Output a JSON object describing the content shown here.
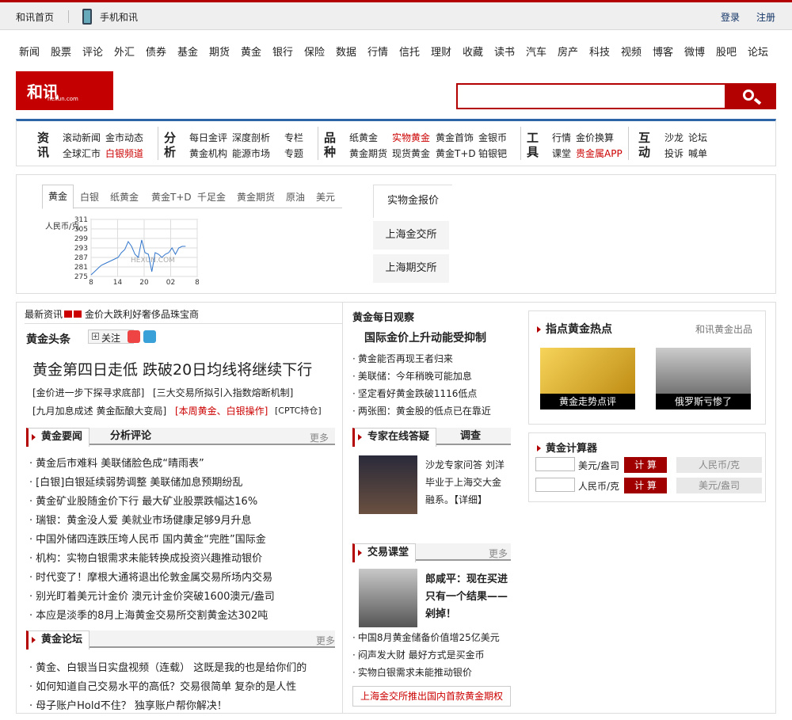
{
  "topbar": {
    "home": "和讯首页",
    "mobile": "手机和讯",
    "login": "登录",
    "register": "注册"
  },
  "nav": [
    "新闻",
    "股票",
    "评论",
    "外汇",
    "债券",
    "基金",
    "期货",
    "黄金",
    "银行",
    "保险",
    "数据",
    "行情",
    "信托",
    "理财",
    "收藏",
    "读书",
    "汽车",
    "房产",
    "科技",
    "视频",
    "博客",
    "微博",
    "股吧",
    "论坛"
  ],
  "logo": {
    "text": "和讯",
    "sub": "hexun.com"
  },
  "search": {
    "placeholder": ""
  },
  "categories": {
    "zixun": {
      "title": "资讯",
      "r1": [
        "滚动新闻",
        "金市动态"
      ],
      "r2": [
        "全球汇市",
        "白银频道"
      ]
    },
    "fenxi": {
      "title": "分析",
      "r1": [
        "每日金评",
        "深度剖析",
        "专栏"
      ],
      "r2": [
        "黄金机构",
        "能源市场",
        "专题"
      ]
    },
    "pinzhong": {
      "title": "品种",
      "r1": [
        "纸黄金",
        "实物黄金",
        "黄金首饰",
        "金银币"
      ],
      "r2": [
        "黄金期货",
        "现货黄金",
        "黄金T+D",
        "铂银钯"
      ]
    },
    "gongju": {
      "title": "工具",
      "r1": [
        "行情",
        "金价换算"
      ],
      "r2": [
        "课堂",
        "贵金属APP"
      ]
    },
    "hudong": {
      "title": "互动",
      "r1": [
        "沙龙",
        "论坛"
      ],
      "r2": [
        "投诉",
        "喊单"
      ]
    }
  },
  "quote": {
    "tabs": [
      "黄金",
      "白银",
      "纸黄金",
      "黄金T+D",
      "千足金",
      "黄金期货",
      "原油",
      "美元"
    ],
    "side": [
      "实物金报价",
      "上海金交所",
      "上海期交所"
    ],
    "ylabel": "人民币/克",
    "watermark": "HEXUN.COM"
  },
  "chart_data": {
    "type": "line",
    "ylabel": "人民币/克",
    "yticks": [
      311,
      305,
      299,
      293,
      287,
      281,
      275
    ],
    "xticks": [
      "8",
      "14",
      "20",
      "02",
      "8"
    ],
    "ylim": [
      275,
      311
    ],
    "values": [
      276,
      278,
      280,
      282,
      283,
      284,
      285,
      286,
      287,
      290,
      292,
      297,
      294,
      289,
      287,
      298,
      290,
      289,
      278,
      290,
      289,
      287,
      289,
      290,
      293,
      289,
      293,
      294,
      294
    ]
  },
  "left": {
    "latest": {
      "label": "最新资讯",
      "text": "金价大跌利好奢侈品珠宝商"
    },
    "headline": {
      "label": "黄金头条",
      "follow": "关注",
      "main": "黄金第四日走低 跌破20日均线将继续下行",
      "sub1": [
        "[金价进一步下探寻求底部]",
        "[三大交易所拟引入指数熔断机制]"
      ],
      "sub2": [
        "[九月加息成述 黄金酝酿大变局]",
        "[本周黄金、白银操作]",
        "[CPTC持仓]"
      ]
    },
    "news": {
      "tab1": "黄金要闻",
      "tab2": "分析评论",
      "more": "更多",
      "items": [
        "黄金后市难料 美联储脸色成“晴雨表”",
        "[白银]白银延续弱势调整 美联储加息预期纷乱",
        "黄金矿业股随金价下行 最大矿业股票跌幅达16%",
        "瑞银：黄金没人爱 美就业市场健康足够9月升息",
        "中国外储四连跌压垮人民币 国内黄金“完胜”国际金",
        "机构：实物白银需求未能转换成投资兴趣推动银价",
        "时代变了！摩根大通将退出伦敦金属交易所场内交易",
        "别光盯着美元计金价 澳元计金价突破1600澳元/盎司",
        "本应是淡季的8月上海黄金交易所交割黄金达302吨"
      ]
    },
    "forum": {
      "tab": "黄金论坛",
      "more": "更多",
      "items": [
        "黄金、白银当日实盘视频（连载） 这既是我的也是给你们的",
        "如何知道自己交易水平的高低？交易很简单 复杂的是人性",
        "母子账户Hold不住？ 独享账户帮你解决！"
      ]
    }
  },
  "mid": {
    "daily": {
      "label": "黄金每日观察",
      "title": "国际金价上升动能受抑制",
      "items": [
        "黄金能否再现王者归来",
        "美联储：今年稍晚可能加息",
        "坚定看好黄金跌破1116低点",
        "两张图：黄金股的低点已在靠近"
      ]
    },
    "expert": {
      "tab1": "专家在线答疑",
      "tab2": "调查",
      "text1": "沙龙专家问答 刘洋",
      "text2": "毕业于上海交大金",
      "text3": "融系。【详细】"
    },
    "class": {
      "tab": "交易课堂",
      "more": "更多",
      "title1": "郎咸平：现在买进",
      "title2": "只有一个结果——",
      "title3": "剁掉！",
      "items": [
        "中国8月黄金储备价值增25亿美元",
        "闷声发大财 最好方式是买金币",
        "实物白银需求未能推动银价"
      ],
      "banner": "上海金交所推出国内首款黄金期权"
    }
  },
  "right": {
    "hot": {
      "title": "指点黄金热点",
      "source": "和讯黄金出品",
      "cap1": "黄金走势点评",
      "cap2": "俄罗斯亏惨了"
    },
    "calc": {
      "title": "黄金计算器",
      "unit1": "美元/盎司",
      "unit2": "人民币/克",
      "btn": "计 算",
      "out1": "人民币/克",
      "out2": "美元/盎司"
    }
  }
}
